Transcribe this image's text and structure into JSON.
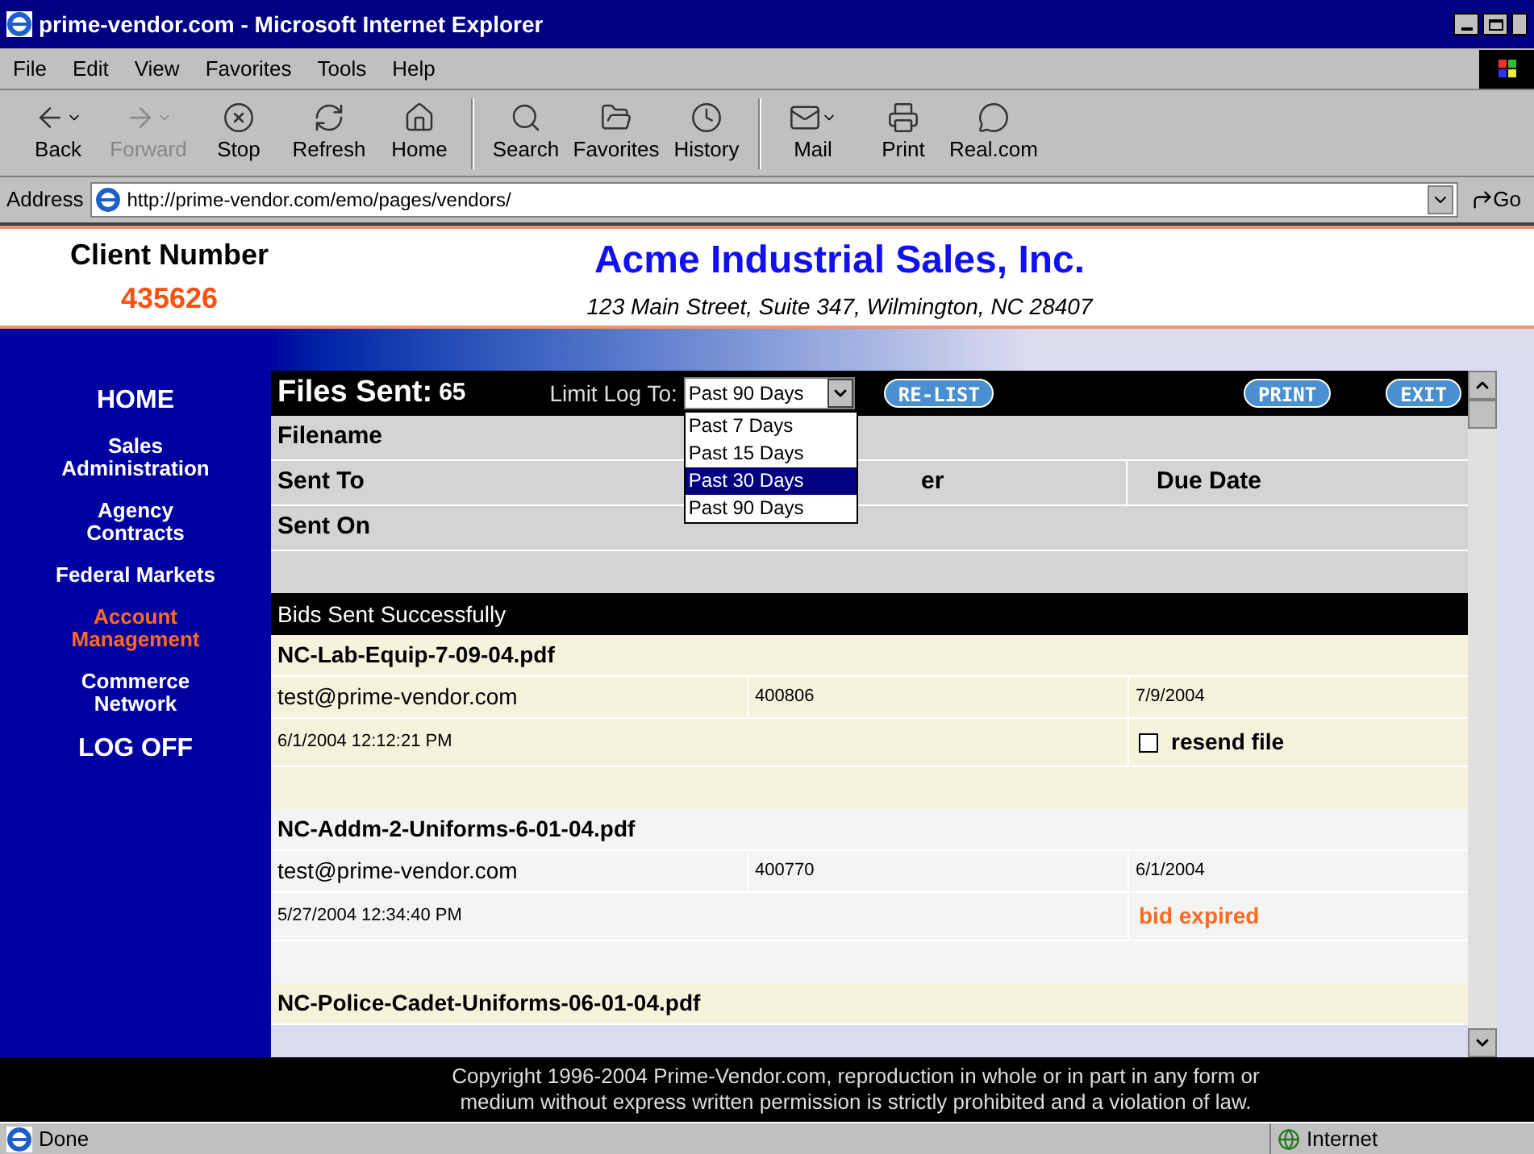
{
  "window": {
    "title": "prime-vendor.com - Microsoft Internet Explorer"
  },
  "menu": [
    "File",
    "Edit",
    "View",
    "Favorites",
    "Tools",
    "Help"
  ],
  "toolbar": [
    {
      "label": "Back",
      "kind": "back",
      "disabled": false,
      "dropdown": true
    },
    {
      "label": "Forward",
      "kind": "forward",
      "disabled": true,
      "dropdown": true
    },
    {
      "label": "Stop",
      "kind": "stop",
      "disabled": false,
      "dropdown": false
    },
    {
      "label": "Refresh",
      "kind": "refresh",
      "disabled": false,
      "dropdown": false
    },
    {
      "label": "Home",
      "kind": "home",
      "disabled": false,
      "dropdown": false
    },
    {
      "label": "Search",
      "kind": "search",
      "disabled": false,
      "dropdown": false
    },
    {
      "label": "Favorites",
      "kind": "favorites",
      "disabled": false,
      "dropdown": false
    },
    {
      "label": "History",
      "kind": "history",
      "disabled": false,
      "dropdown": false
    },
    {
      "label": "Mail",
      "kind": "mail",
      "disabled": false,
      "dropdown": true
    },
    {
      "label": "Print",
      "kind": "print",
      "disabled": false,
      "dropdown": false
    },
    {
      "label": "Real.com",
      "kind": "real",
      "disabled": false,
      "dropdown": false
    }
  ],
  "address": {
    "label": "Address",
    "url": "http://prime-vendor.com/emo/pages/vendors/",
    "go": "Go"
  },
  "client": {
    "label": "Client Number",
    "number": "435626"
  },
  "company": {
    "name": "Acme Industrial Sales, Inc.",
    "address": "123 Main Street, Suite 347, Wilmington, NC 28407"
  },
  "nav": [
    {
      "label": "HOME",
      "kind": "large",
      "selected": false
    },
    {
      "label": "Sales Administration",
      "kind": "small",
      "selected": false
    },
    {
      "label": "Agency Contracts",
      "kind": "small",
      "selected": false
    },
    {
      "label": "Federal Markets",
      "kind": "small",
      "selected": false
    },
    {
      "label": "Account Management",
      "kind": "small",
      "selected": true
    },
    {
      "label": "Commerce Network",
      "kind": "small",
      "selected": false
    },
    {
      "label": "LOG OFF",
      "kind": "large",
      "selected": false
    }
  ],
  "files": {
    "title": "Files Sent:",
    "count": "65",
    "limit_label": "Limit Log To:",
    "limit_value": "Past 90 Days",
    "options": [
      {
        "label": "Past 7 Days",
        "selected": false
      },
      {
        "label": "Past 15 Days",
        "selected": false
      },
      {
        "label": "Past 30 Days",
        "selected": true
      },
      {
        "label": "Past 90 Days",
        "selected": false
      }
    ],
    "buttons": [
      "RE-LIST",
      "PRINT",
      "EXIT"
    ]
  },
  "columns": {
    "filename": "Filename",
    "sent_to": "Sent To",
    "column_2": "er",
    "due_date": "Due Date",
    "sent_on": "Sent On"
  },
  "section": "Bids Sent Successfully",
  "records": [
    {
      "filename": "NC-Lab-Equip-7-09-04.pdf",
      "sent_to": "test@prime-vendor.com",
      "number": "400806",
      "due_date": "7/9/2004",
      "sent_on": "6/1/2004 12:12:21 PM",
      "status": {
        "kind": "resend",
        "label": "resend file",
        "checked": false
      }
    },
    {
      "filename": "NC-Addm-2-Uniforms-6-01-04.pdf",
      "sent_to": "test@prime-vendor.com",
      "number": "400770",
      "due_date": "6/1/2004",
      "sent_on": "5/27/2004 12:34:40 PM",
      "status": {
        "kind": "expired",
        "label": "bid expired"
      }
    },
    {
      "filename": "NC-Police-Cadet-Uniforms-06-01-04.pdf"
    }
  ],
  "footer": [
    "Copyright 1996-2004 Prime-Vendor.com, reproduction in whole or in part in any form or",
    "medium without express written permission is strictly prohibited and a violation of law."
  ],
  "status_bar": {
    "text": "Done",
    "zone": "Internet"
  }
}
